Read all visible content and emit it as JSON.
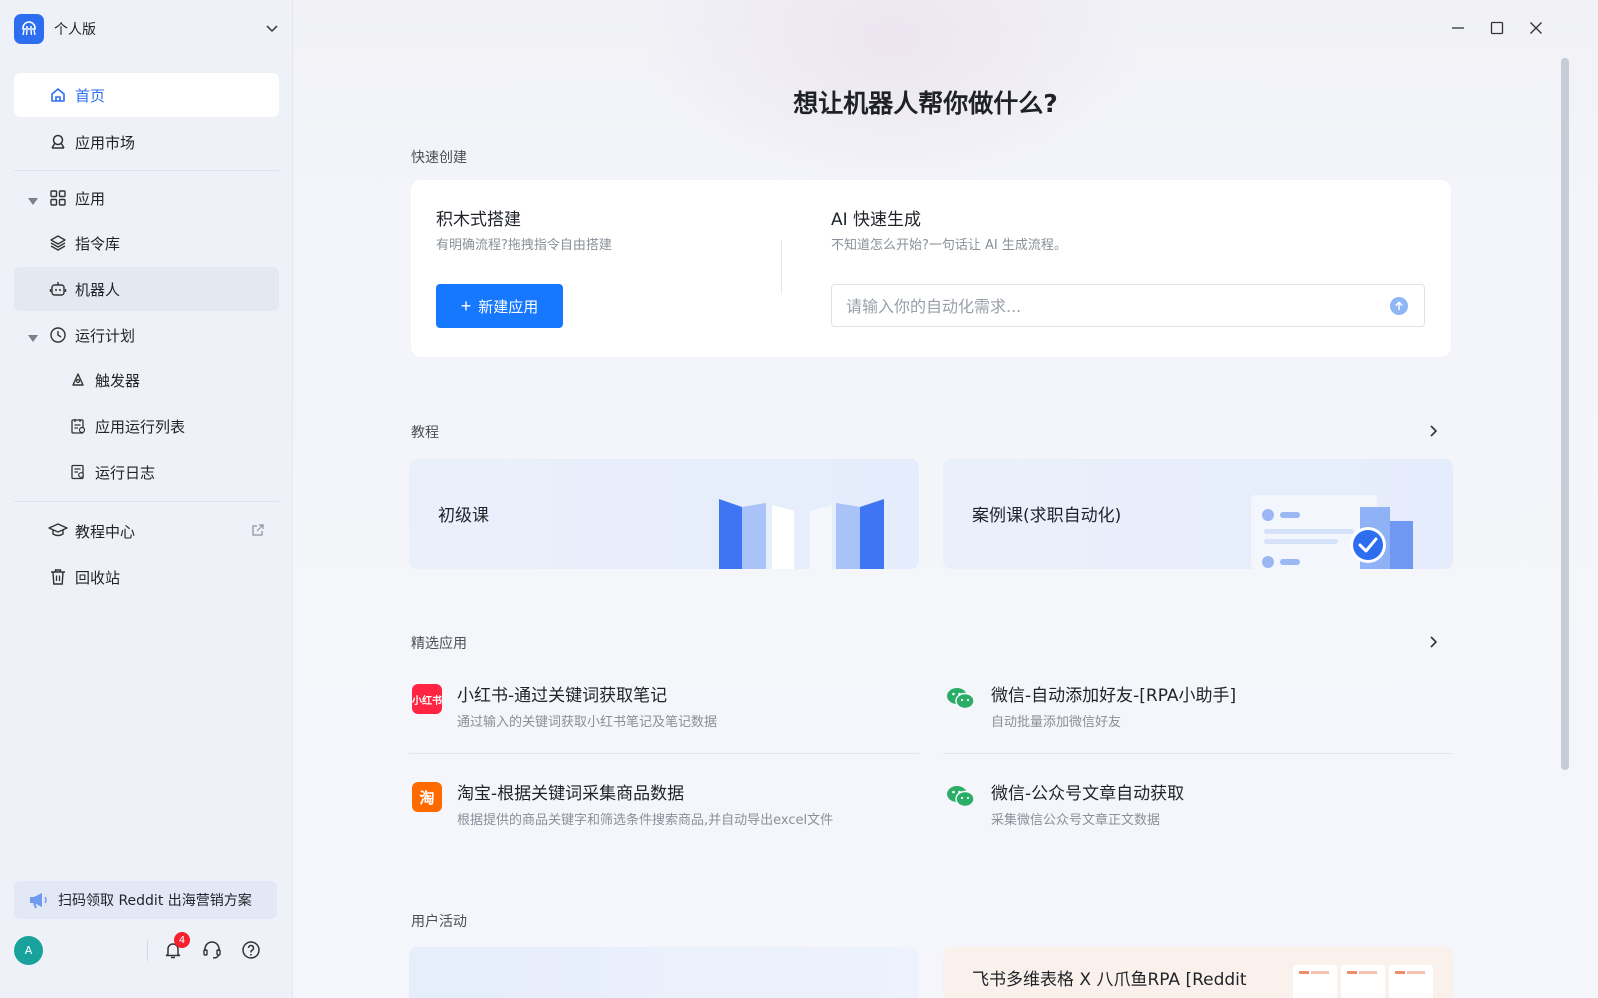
{
  "workspace": {
    "name": "个人版"
  },
  "nav": {
    "home": "首页",
    "market": "应用市场",
    "apps": "应用",
    "commands": "指令库",
    "robots": "机器人",
    "schedule": "运行计划",
    "triggers": "触发器",
    "run_list": "应用运行列表",
    "run_logs": "运行日志",
    "tutorials": "教程中心",
    "recycle": "回收站"
  },
  "promo": {
    "text": "扫码领取 Reddit 出海营销方案"
  },
  "user": {
    "avatar_initial": "A",
    "notification_count": "4"
  },
  "hero": {
    "title": "想让机器人帮你做什么?"
  },
  "quick_create": {
    "label": "快速创建",
    "block": {
      "title": "积木式搭建",
      "desc": "有明确流程?拖拽指令自由搭建",
      "button": "新建应用"
    },
    "ai": {
      "title": "AI 快速生成",
      "desc": "不知道怎么开始?一句话让 AI 生成流程。",
      "placeholder": "请输入你的自动化需求..."
    }
  },
  "tutorials": {
    "label": "教程",
    "cards": [
      {
        "title": "初级课"
      },
      {
        "title": "案例课(求职自动化)"
      }
    ]
  },
  "featured": {
    "label": "精选应用",
    "apps": [
      {
        "icon_text": "小红书",
        "icon": "xiaohongshu-icon",
        "color": "#ff2442",
        "title": "小红书-通过关键词获取笔记",
        "desc": "通过输入的关键词获取小红书笔记及笔记数据"
      },
      {
        "icon": "wechat-icon",
        "color": "#2aae67",
        "title": "微信-自动添加好友-[RPA小助手]",
        "desc": "自动批量添加微信好友"
      },
      {
        "icon_text": "淘",
        "icon": "taobao-icon",
        "color": "#ff6a00",
        "title": "淘宝-根据关键词采集商品数据",
        "desc": "根据提供的商品关键字和筛选条件搜索商品,并自动导出excel文件"
      },
      {
        "icon": "wechat-icon",
        "color": "#2aae67",
        "title": "微信-公众号文章自动获取",
        "desc": "采集微信公众号文章正文数据"
      }
    ]
  },
  "activities": {
    "label": "用户活动",
    "cards": [
      {
        "title": ""
      },
      {
        "title": "飞书多维表格 X 八爪鱼RPA [Reddit"
      }
    ]
  },
  "colors": {
    "accent": "#1677ff",
    "active_nav": "#2d6ef0"
  }
}
